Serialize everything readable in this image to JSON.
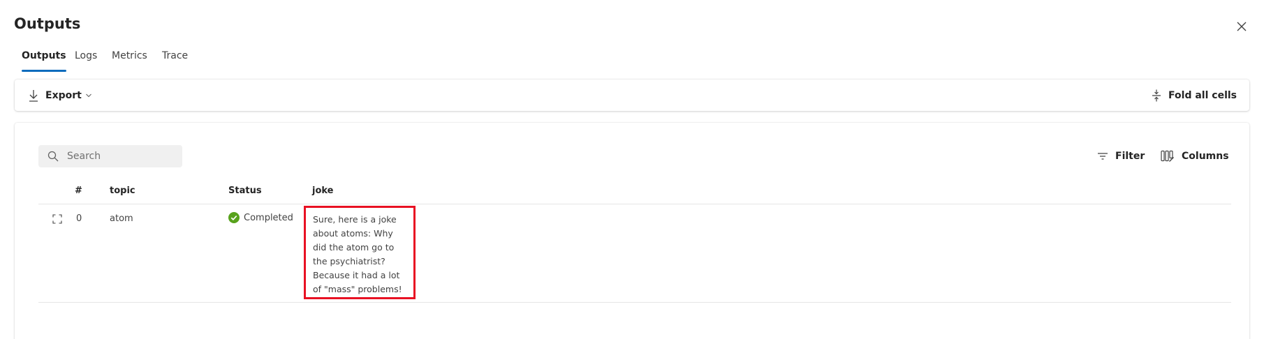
{
  "panel": {
    "title": "Outputs"
  },
  "tabs": [
    {
      "label": "Outputs",
      "active": true
    },
    {
      "label": "Logs",
      "active": false
    },
    {
      "label": "Metrics",
      "active": false
    },
    {
      "label": "Trace",
      "active": false
    }
  ],
  "toolbar": {
    "export_label": "Export",
    "fold_label": "Fold all cells",
    "export_icon": "download-icon",
    "fold_icon": "fold-cells-icon"
  },
  "grid": {
    "search_placeholder": "Search",
    "search_value": "",
    "filter_label": "Filter",
    "columns_label": "Columns",
    "headers": {
      "index": "#",
      "topic": "topic",
      "status": "Status",
      "joke": "joke"
    },
    "rows": [
      {
        "index": "0",
        "topic": "atom",
        "status": "Completed",
        "joke": "Sure, here is a joke about atoms: Why did the atom go to the psychiatrist? Because it had a lot of \"mass\" problems!"
      }
    ]
  },
  "colors": {
    "accent": "#0f6cbd",
    "success": "#58a21c",
    "highlight": "#e81123"
  }
}
